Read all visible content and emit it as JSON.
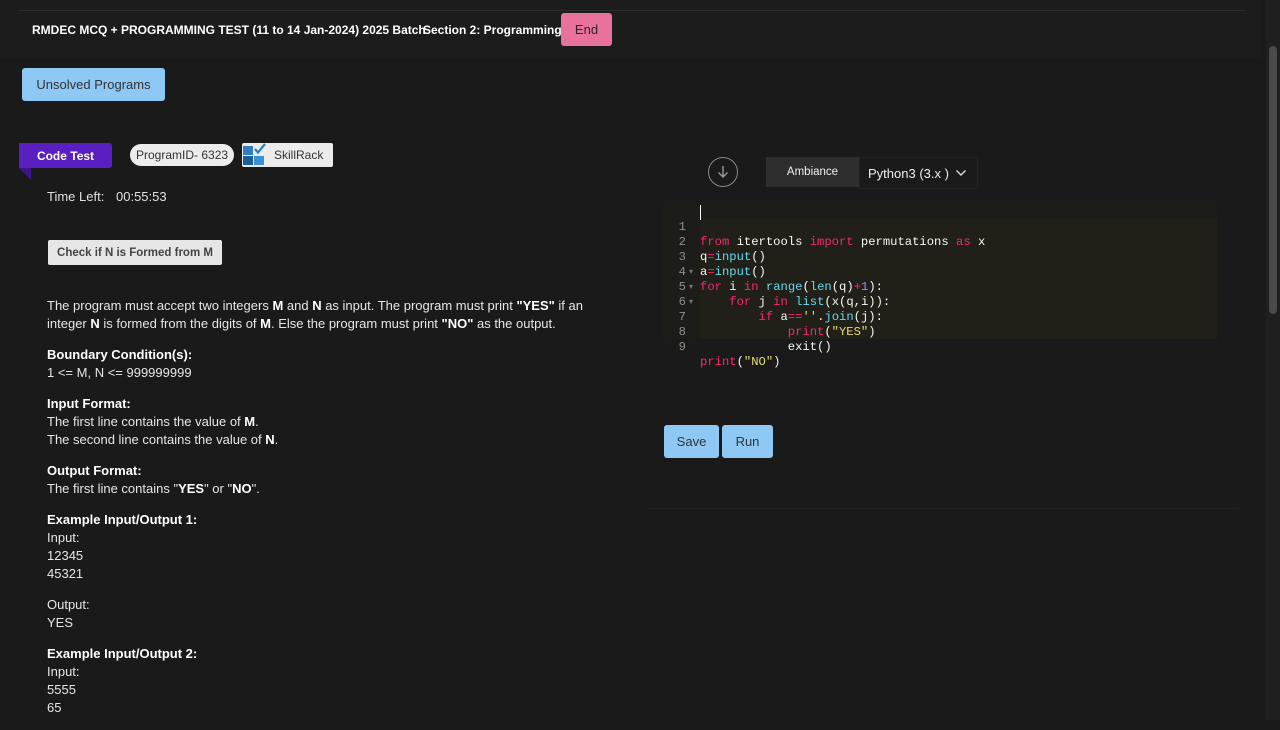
{
  "header": {
    "test_title": "RMDEC MCQ + PROGRAMMING TEST (11 to 14 Jan-2024) 2025 Batch",
    "section_title": "Section 2: Programming",
    "end_label": "End"
  },
  "unsolved_label": "Unsolved Programs",
  "tags": {
    "code_test": "Code Test",
    "program_id": "ProgramID- 6323",
    "skillrack": "SkillRack"
  },
  "timer": {
    "label": "Time Left:",
    "value": "00:55:53"
  },
  "problem": {
    "title": "Check if N is Formed from M",
    "description": {
      "p1": "The program must accept two integers ",
      "m": "M",
      "p2": " and ",
      "n": "N",
      "p3": " as input. The program must print ",
      "yes": "\"YES\"",
      "p4": " if an integer ",
      "n2": "N",
      "p5": " is formed from the digits of ",
      "m2": "M",
      "p6": ". Else the program must print ",
      "no": "\"NO\"",
      "p7": " as the output."
    },
    "boundary_heading": "Boundary Condition(s):",
    "boundary_text": "1 <= M, N <= 999999999",
    "input_heading": "Input Format:",
    "input_line1_a": "The first line contains the value of ",
    "input_line1_b": "M",
    "input_line1_c": ".",
    "input_line2_a": "The second line contains the value of ",
    "input_line2_b": "N",
    "input_line2_c": ".",
    "output_heading": "Output Format:",
    "output_a": "The first line contains \"",
    "output_b": "YES",
    "output_c": "\" or \"",
    "output_d": "NO",
    "output_e": "\".",
    "example1_heading": "Example Input/Output 1:",
    "example1_input_label": "Input:",
    "example1_input_1": "12345",
    "example1_input_2": "45321",
    "example1_output_label": "Output:",
    "example1_output": "YES",
    "example2_heading": "Example Input/Output 2:",
    "example2_input_label": "Input:",
    "example2_input_1": "5555",
    "example2_input_2": "65"
  },
  "editor_toolbar": {
    "theme": "Ambiance",
    "language": "Python3 (3.x )"
  },
  "code_lines": [
    "from itertools import permutations as x",
    "q=input()",
    "a=input()",
    "for i in range(len(q)+1):",
    "    for j in list(x(q,i)):",
    "        if a==''.join(j):",
    "            print(\"YES\")",
    "            exit()",
    "print(\"NO\")"
  ],
  "line_numbers": [
    "1",
    "2",
    "3",
    "4",
    "5",
    "6",
    "7",
    "8",
    "9"
  ],
  "actions": {
    "save": "Save",
    "run": "Run"
  },
  "colors": {
    "end_button": "#e8719d",
    "primary_button": "#8ec8f5",
    "code_test_tag": "#5a1fc0",
    "keyword": "#f92672",
    "builtin": "#66d9ef",
    "string": "#e6db74",
    "number": "#ae81ff"
  }
}
